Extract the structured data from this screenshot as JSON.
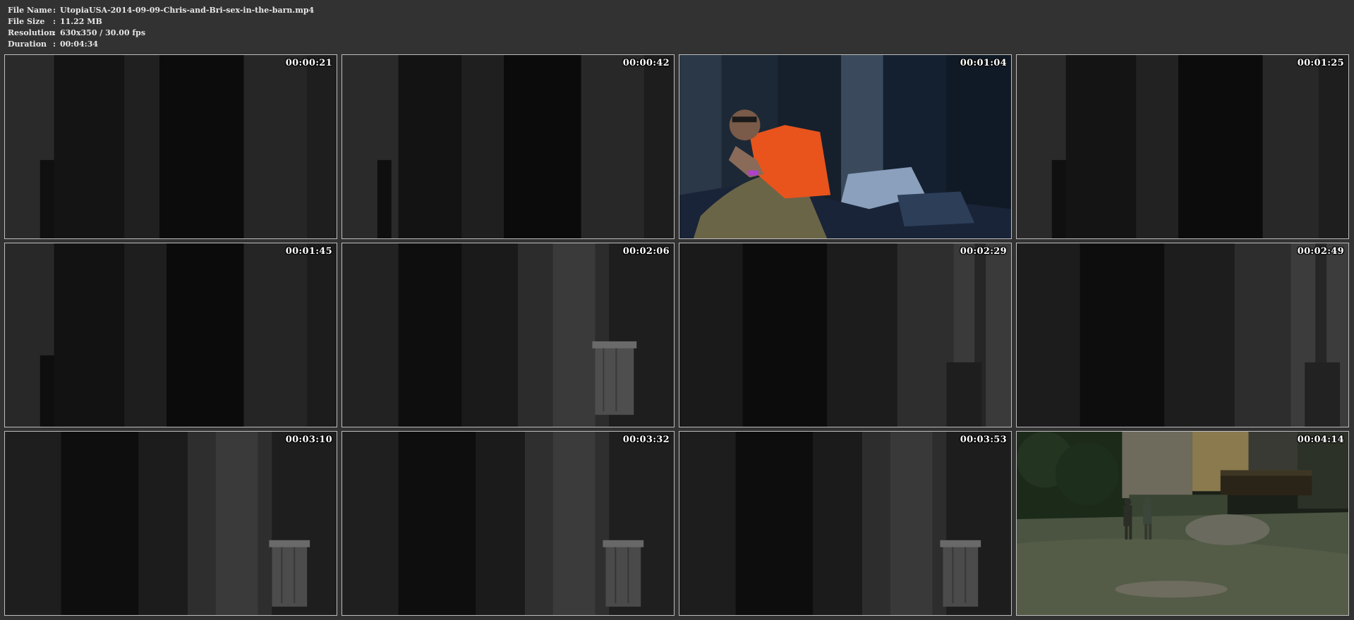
{
  "file_info": {
    "file_name": {
      "label": "File Name",
      "value": "UtopiaUSA-2014-09-09-Chris-and-Bri-sex-in-the-barn.mp4"
    },
    "file_size": {
      "label": "File Size",
      "value": "11.22 MB"
    },
    "resolution": {
      "label": "Resolution",
      "value": "630x350 / 30.00 fps"
    },
    "duration": {
      "label": "Duration",
      "value": "00:04:34"
    },
    "separator": ":"
  },
  "thumbnails": [
    {
      "timestamp": "00:00:21",
      "scene": "dark-barn-wall"
    },
    {
      "timestamp": "00:00:42",
      "scene": "dark-barn-wall"
    },
    {
      "timestamp": "00:01:04",
      "scene": "man-orange-shirt-sitting"
    },
    {
      "timestamp": "00:01:25",
      "scene": "dark-barn-wall"
    },
    {
      "timestamp": "00:01:45",
      "scene": "dark-barn-wall"
    },
    {
      "timestamp": "00:02:06",
      "scene": "barn-wall-with-trash-can"
    },
    {
      "timestamp": "00:02:29",
      "scene": "barn-wall-with-post"
    },
    {
      "timestamp": "00:02:49",
      "scene": "barn-wall-with-post"
    },
    {
      "timestamp": "00:03:10",
      "scene": "barn-wall-with-trash-can"
    },
    {
      "timestamp": "00:03:32",
      "scene": "barn-wall-with-trash-can"
    },
    {
      "timestamp": "00:03:53",
      "scene": "barn-wall-with-trash-can"
    },
    {
      "timestamp": "00:04:14",
      "scene": "outdoor-night-two-people-walking"
    }
  ],
  "colors": {
    "background": "#323232",
    "header_text": "#e6e6e6",
    "thumb_border": "#bdbdbd",
    "timestamp_text": "#ffffff"
  }
}
